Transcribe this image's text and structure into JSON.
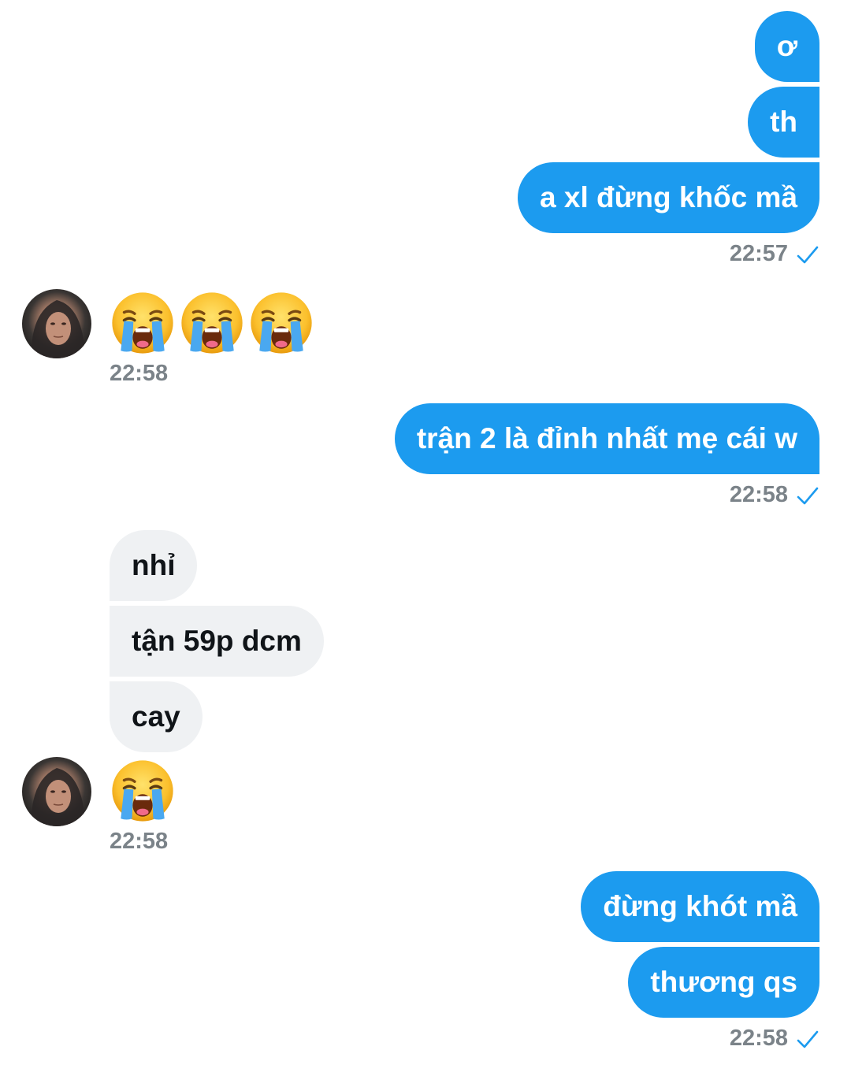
{
  "colors": {
    "outgoing_bubble": "#1c9bef",
    "incoming_bubble": "#eff1f3",
    "timestamp": "#7b8389",
    "read_check": "#1c9bef"
  },
  "messages": {
    "out1": {
      "text": "ơ"
    },
    "out2": {
      "text": "th"
    },
    "out3": {
      "text": "a xl đừng khốc mầ",
      "time": "22:57"
    },
    "in1": {
      "emoji": [
        "loudly-crying-face",
        "loudly-crying-face",
        "loudly-crying-face"
      ],
      "time": "22:58"
    },
    "out4": {
      "text": "trận 2 là đỉnh nhất mẹ cái w",
      "time": "22:58"
    },
    "in2": {
      "text": "nhỉ"
    },
    "in3": {
      "text": "tận 59p dcm"
    },
    "in4": {
      "text": "cay"
    },
    "in5": {
      "emoji": [
        "loudly-crying-face"
      ],
      "time": "22:58"
    },
    "out5": {
      "text": "đừng khót mầ"
    },
    "out6": {
      "text": "thương qs",
      "time": "22:58"
    }
  }
}
